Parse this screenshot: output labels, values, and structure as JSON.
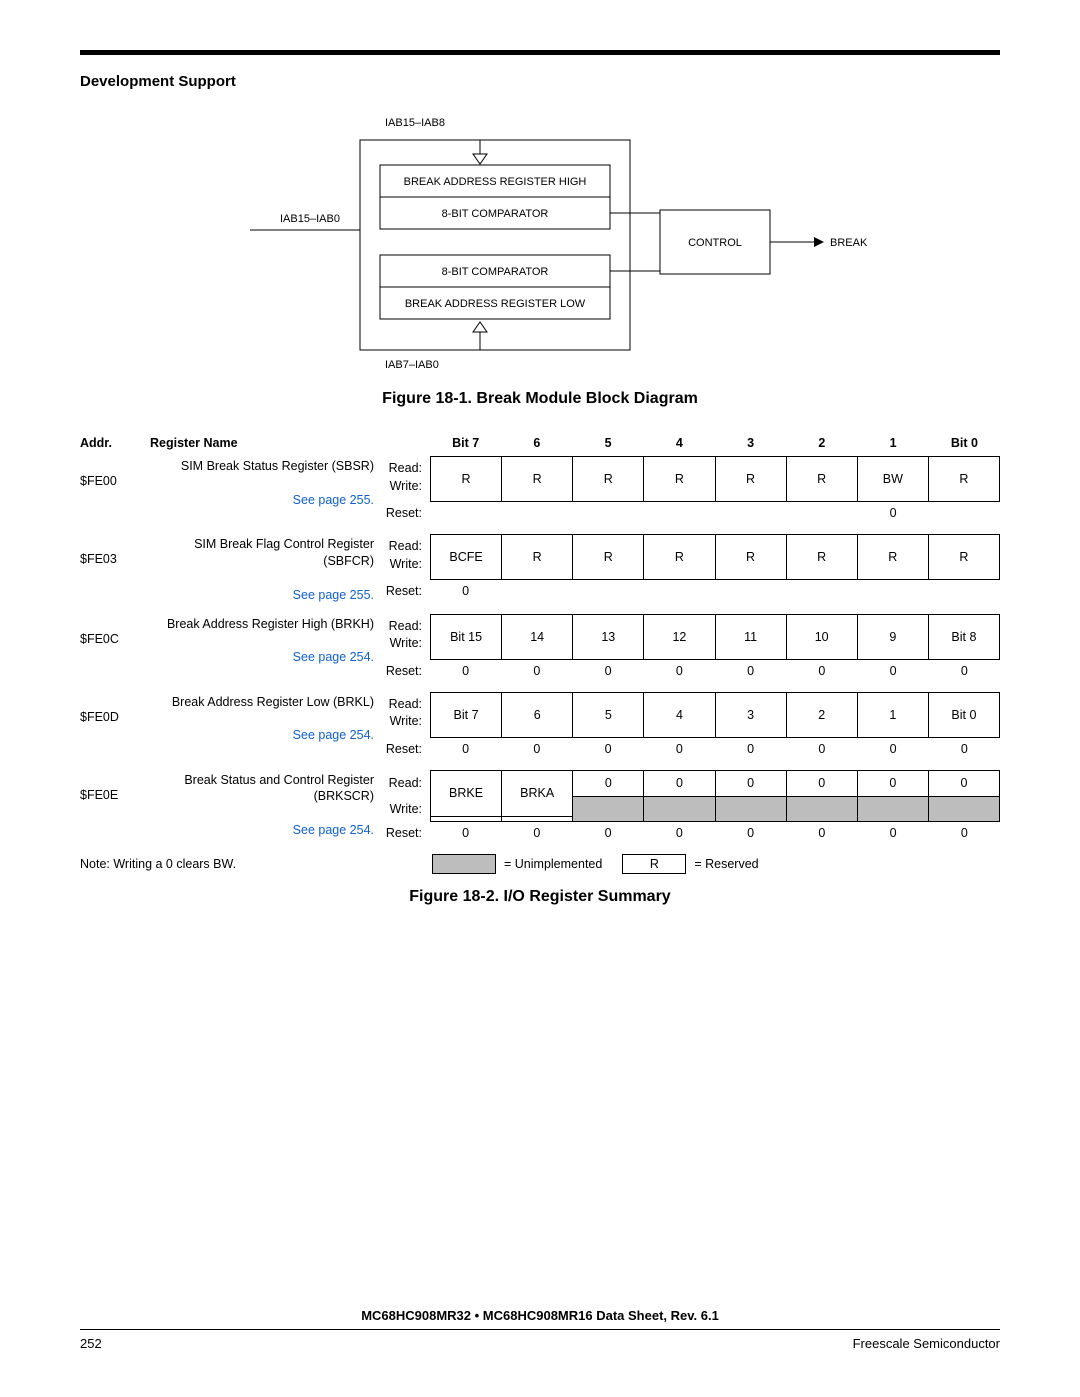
{
  "header": {
    "section": "Development Support"
  },
  "diagram": {
    "top_bus": "IAB15–IAB8",
    "left_bus": "IAB15–IAB0",
    "bottom_bus": "IAB7–IAB0",
    "box1": "BREAK ADDRESS REGISTER HIGH",
    "box2": "8-BIT COMPARATOR",
    "box3": "8-BIT COMPARATOR",
    "box4": "BREAK ADDRESS REGISTER LOW",
    "control": "CONTROL",
    "break": "BREAK"
  },
  "captions": {
    "fig1": "Figure 18-1. Break Module Block Diagram",
    "fig2": "Figure 18-2. I/O Register Summary"
  },
  "table": {
    "headers": {
      "addr": "Addr.",
      "name": "Register Name",
      "bits": [
        "Bit 7",
        "6",
        "5",
        "4",
        "3",
        "2",
        "1",
        "Bit 0"
      ]
    },
    "rw_labels": {
      "read": "Read:",
      "write": "Write:",
      "reset": "Reset:"
    },
    "rows": [
      {
        "addr": "$FE00",
        "name": "SIM Break Status Register (SBSR)",
        "link": "See page 255.",
        "read": [
          "R",
          "R",
          "R",
          "R",
          "R",
          "R",
          "BW",
          "R"
        ],
        "write": null,
        "reset": [
          "",
          "",
          "",
          "",
          "",
          "",
          "0",
          ""
        ]
      },
      {
        "addr": "$FE03",
        "name": "SIM Break Flag Control Register (SBFCR)",
        "link": "See page 255.",
        "read": [
          "BCFE",
          "R",
          "R",
          "R",
          "R",
          "R",
          "R",
          "R"
        ],
        "write": null,
        "reset": [
          "0",
          "",
          "",
          "",
          "",
          "",
          "",
          ""
        ]
      },
      {
        "addr": "$FE0C",
        "name": "Break Address Register High (BRKH)",
        "link": "See page 254.",
        "read": [
          "Bit 15",
          "14",
          "13",
          "12",
          "11",
          "10",
          "9",
          "Bit 8"
        ],
        "write": null,
        "reset": [
          "0",
          "0",
          "0",
          "0",
          "0",
          "0",
          "0",
          "0"
        ]
      },
      {
        "addr": "$FE0D",
        "name": "Break Address Register Low (BRKL)",
        "link": "See page 254.",
        "read": [
          "Bit 7",
          "6",
          "5",
          "4",
          "3",
          "2",
          "1",
          "Bit 0"
        ],
        "write": null,
        "reset": [
          "0",
          "0",
          "0",
          "0",
          "0",
          "0",
          "0",
          "0"
        ]
      },
      {
        "addr": "$FE0E",
        "name": "Break Status and Control Register (BRKSCR)",
        "link": "See page 254.",
        "read": [
          "BRKE",
          "BRKA",
          "0",
          "0",
          "0",
          "0",
          "0",
          "0"
        ],
        "write_shade_from": 2,
        "reset": [
          "0",
          "0",
          "0",
          "0",
          "0",
          "0",
          "0",
          "0"
        ]
      }
    ],
    "note": "Note: Writing a 0 clears BW.",
    "legend": {
      "unimpl": "= Unimplemented",
      "r": "R",
      "reserved": "= Reserved"
    }
  },
  "footer": {
    "docline": "MC68HC908MR32 • MC68HC908MR16 Data Sheet, Rev. 6.1",
    "page": "252",
    "company": "Freescale Semiconductor"
  }
}
